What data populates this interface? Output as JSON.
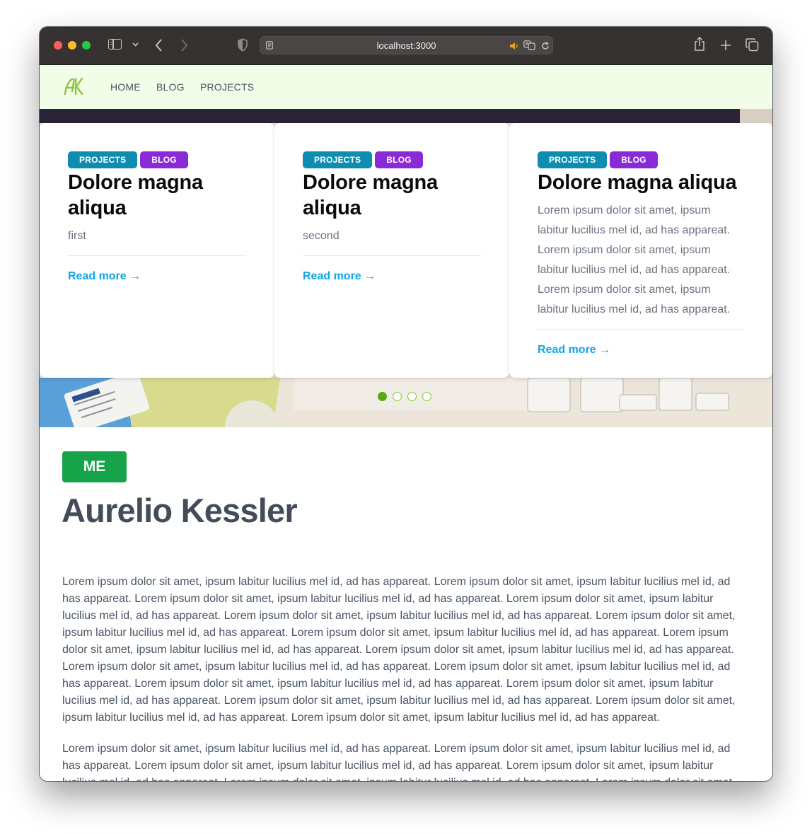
{
  "browser": {
    "url": "localhost:3000"
  },
  "nav": {
    "logo_text": "AK",
    "links": [
      "HOME",
      "BLOG",
      "PROJECTS"
    ]
  },
  "carousel": {
    "cards": [
      {
        "badges": [
          "PROJECTS",
          "BLOG"
        ],
        "title": "Dolore magna aliqua",
        "description": "first",
        "read_more": "Read more →"
      },
      {
        "badges": [
          "PROJECTS",
          "BLOG"
        ],
        "title": "Dolore magna aliqua",
        "description": "second",
        "read_more": "Read more →"
      },
      {
        "badges": [
          "PROJECTS",
          "BLOG"
        ],
        "title": "Dolore magna aliqua",
        "description": "Lorem ipsum dolor sit amet, ipsum labitur lucilius mel id, ad has appareat. Lorem ipsum dolor sit amet, ipsum labitur lucilius mel id, ad has appareat. Lorem ipsum dolor sit amet, ipsum labitur lucilius mel id, ad has appareat.",
        "read_more": "Read more →"
      }
    ],
    "dots": 4,
    "active_dot": 1
  },
  "about": {
    "badge": "ME",
    "name": "Aurelio Kessler",
    "paragraphs": [
      "Lorem ipsum dolor sit amet, ipsum labitur lucilius mel id, ad has appareat. Lorem ipsum dolor sit amet, ipsum labitur lucilius mel id, ad has appareat. Lorem ipsum dolor sit amet, ipsum labitur lucilius mel id, ad has appareat. Lorem ipsum dolor sit amet, ipsum labitur lucilius mel id, ad has appareat. Lorem ipsum dolor sit amet, ipsum labitur lucilius mel id, ad has appareat. Lorem ipsum dolor sit amet, ipsum labitur lucilius mel id, ad has appareat. Lorem ipsum dolor sit amet, ipsum labitur lucilius mel id, ad has appareat. Lorem ipsum dolor sit amet, ipsum labitur lucilius mel id, ad has appareat. Lorem ipsum dolor sit amet, ipsum labitur lucilius mel id, ad has appareat. Lorem ipsum dolor sit amet, ipsum labitur lucilius mel id, ad has appareat. Lorem ipsum dolor sit amet, ipsum labitur lucilius mel id, ad has appareat. Lorem ipsum dolor sit amet, ipsum labitur lucilius mel id, ad has appareat. Lorem ipsum dolor sit amet, ipsum labitur lucilius mel id, ad has appareat. Lorem ipsum dolor sit amet, ipsum labitur lucilius mel id, ad has appareat. Lorem ipsum dolor sit amet, ipsum labitur lucilius mel id, ad has appareat. Lorem ipsum dolor sit amet, ipsum labitur lucilius mel id, ad has appareat.",
      "Lorem ipsum dolor sit amet, ipsum labitur lucilius mel id, ad has appareat. Lorem ipsum dolor sit amet, ipsum labitur lucilius mel id, ad has appareat. Lorem ipsum dolor sit amet, ipsum labitur lucilius mel id, ad has appareat. Lorem ipsum dolor sit amet, ipsum labitur lucilius mel id, ad has appareat. Lorem ipsum dolor sit amet, ipsum labitur lucilius mel id, ad has appareat. Lorem ipsum dolor sit amet, ipsum labitur lucilius mel id, ad has appareat. Lorem ipsum dolor sit amet, ipsum labitur lucilius mel id, ad has appareat. Lorem ipsum dolor sit amet, ipsum labitur lucilius mel id, ad has appareat. Lorem ipsum"
    ]
  },
  "colors": {
    "navbar_bg": "#f1fde6",
    "logo": "#8dc63f",
    "badge_projects": "#0e8db0",
    "badge_blog": "#8a2ad6",
    "link": "#0ea5e9",
    "me_badge": "#16a34a",
    "dot_active": "#5aa814"
  }
}
